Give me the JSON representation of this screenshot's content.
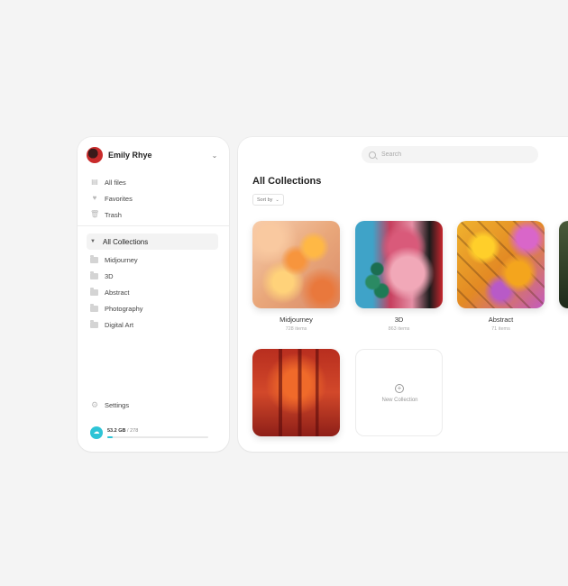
{
  "user": {
    "name": "Emily Rhye"
  },
  "sidebar": {
    "quick_links": [
      {
        "label": "All files",
        "icon": "files-icon"
      },
      {
        "label": "Favorites",
        "icon": "heart-icon"
      },
      {
        "label": "Trash",
        "icon": "trash-icon"
      }
    ],
    "collections_header": "All Collections",
    "folders": [
      {
        "label": "Midjourney"
      },
      {
        "label": "3D"
      },
      {
        "label": "Abstract"
      },
      {
        "label": "Photography"
      },
      {
        "label": "Digital Art"
      }
    ],
    "settings_label": "Settings",
    "storage": {
      "used": "53.2 GB",
      "total": "278",
      "separator": "/",
      "fraction": 0.05
    }
  },
  "main": {
    "search_placeholder": "Search",
    "title": "All Collections",
    "sort_label": "Sort by",
    "collections": [
      {
        "name": "Midjourney",
        "count": "728 items"
      },
      {
        "name": "3D",
        "count": "863 items"
      },
      {
        "name": "Abstract",
        "count": "71 items"
      }
    ],
    "new_collection_label": "New Collection"
  },
  "colors": {
    "accent": "#2ec4d6",
    "background": "#f4f4f4"
  }
}
